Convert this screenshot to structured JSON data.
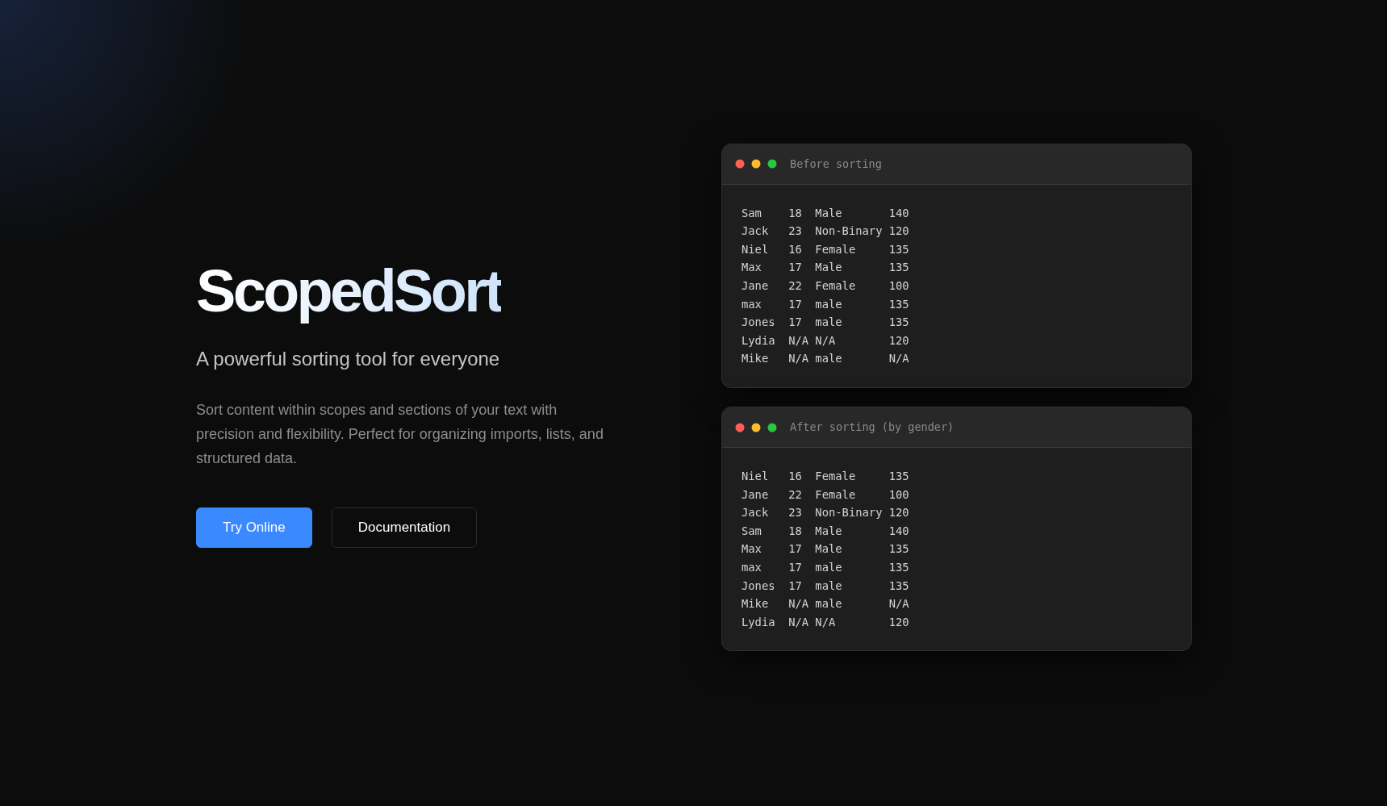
{
  "hero": {
    "title": "ScopedSort",
    "subtitle": "A powerful sorting tool for everyone",
    "description": "Sort content within scopes and sections of your text with precision and flexibility. Perfect for organizing imports, lists, and structured data.",
    "buttons": [
      {
        "label": "Try Online",
        "kind": "primary"
      },
      {
        "label": "Documentation",
        "kind": "secondary"
      }
    ]
  },
  "windows": [
    {
      "title": "Before sorting",
      "lines": [
        "Sam    18  Male       140",
        "Jack   23  Non-Binary 120",
        "Niel   16  Female     135",
        "Max    17  Male       135",
        "Jane   22  Female     100",
        "max    17  male       135",
        "Jones  17  male       135",
        "Lydia  N/A N/A        120",
        "Mike   N/A male       N/A"
      ]
    },
    {
      "title": "After sorting (by gender)",
      "lines": [
        "Niel   16  Female     135",
        "Jane   22  Female     100",
        "Jack   23  Non-Binary 120",
        "Sam    18  Male       140",
        "Max    17  Male       135",
        "max    17  male       135",
        "Jones  17  male       135",
        "Mike   N/A male       N/A",
        "Lydia  N/A N/A        120"
      ]
    }
  ]
}
